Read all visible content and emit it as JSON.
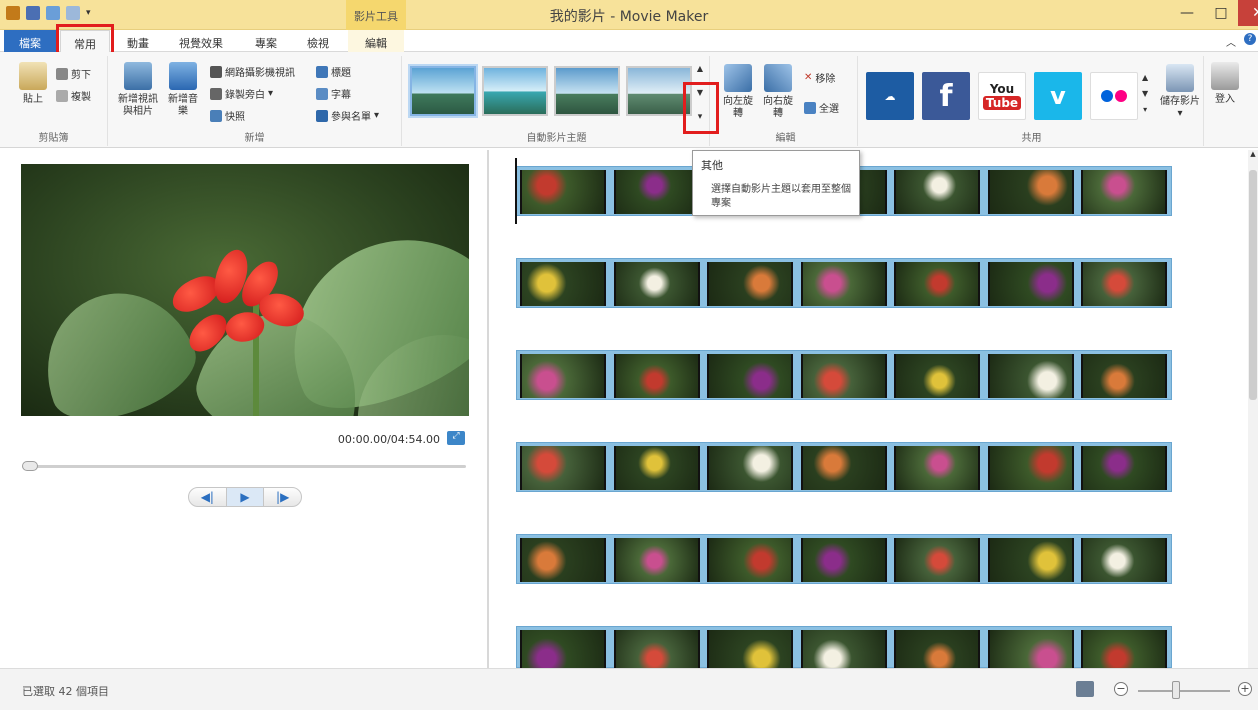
{
  "window": {
    "title": "我的影片 - Movie Maker",
    "context_tab": "影片工具",
    "controls": {
      "minimize": "—",
      "maximize": "□",
      "close": "✕"
    }
  },
  "tabs": [
    {
      "label": "檔案"
    },
    {
      "label": "常用"
    },
    {
      "label": "動畫"
    },
    {
      "label": "視覺效果"
    },
    {
      "label": "專案"
    },
    {
      "label": "檢視"
    },
    {
      "label": "編輯"
    }
  ],
  "ribbon": {
    "clipboard": {
      "label": "剪貼簿",
      "paste": "貼上",
      "cut": "剪下",
      "copy": "複製"
    },
    "add": {
      "label": "新增",
      "add_videos": "新增視訊與相片",
      "add_music": "新增音樂",
      "webcam": "網路攝影機視訊",
      "narration": "錄製旁白",
      "snapshot": "快照",
      "title": "標題",
      "caption": "字幕",
      "credits": "參與名單"
    },
    "themes": {
      "label": "自動影片主題",
      "count": 4
    },
    "editing": {
      "label": "編輯",
      "rotate_left": "向左旋轉",
      "rotate_right": "向右旋轉",
      "remove": "移除",
      "select_all": "全選"
    },
    "share": {
      "label": "共用",
      "save_movie": "儲存影片",
      "signin": "登入",
      "services": [
        "OneDrive",
        "Facebook",
        "YouTube",
        "Vimeo",
        "Flickr"
      ]
    }
  },
  "tooltip": {
    "title": "其他",
    "body": "選擇自動影片主題以套用至整個專案"
  },
  "preview": {
    "timecode": "00:00.00/04:54.00",
    "progress": 0
  },
  "storyboard": {
    "rows": 6,
    "clips_per_row": 7
  },
  "status": {
    "text": "已選取 42 個項目",
    "zoom_level": 0.35
  }
}
